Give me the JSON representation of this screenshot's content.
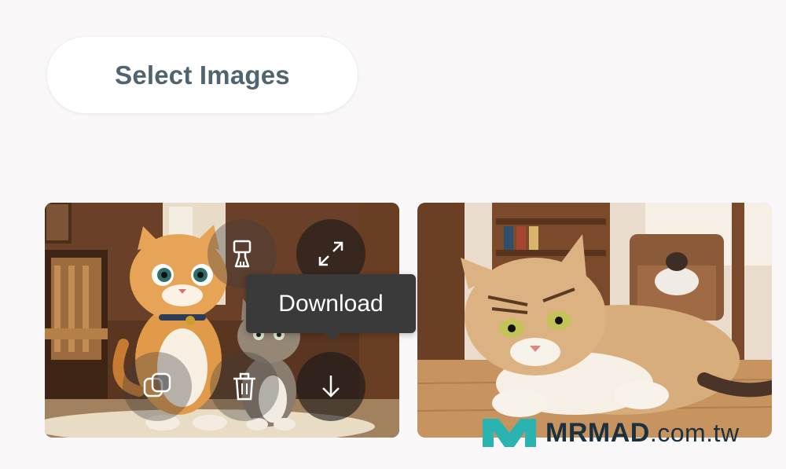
{
  "select_button": {
    "label": "Select Images"
  },
  "images": [
    {
      "alt": "Two cartoon cats sitting in a cozy room"
    },
    {
      "alt": "Tabby cat lying on a wooden floor"
    }
  ],
  "image_actions": [
    {
      "name": "clean-icon"
    },
    {
      "name": "expand-icon"
    },
    {
      "name": "duplicate-icon"
    },
    {
      "name": "delete-icon"
    },
    {
      "name": "download-icon"
    }
  ],
  "tooltip": {
    "label": "Download"
  },
  "watermark": {
    "brand": "MRMAD",
    "domain": ".com.tw"
  },
  "colors": {
    "accent_teal": "#2bb3b1",
    "text_slate": "#50646f"
  }
}
